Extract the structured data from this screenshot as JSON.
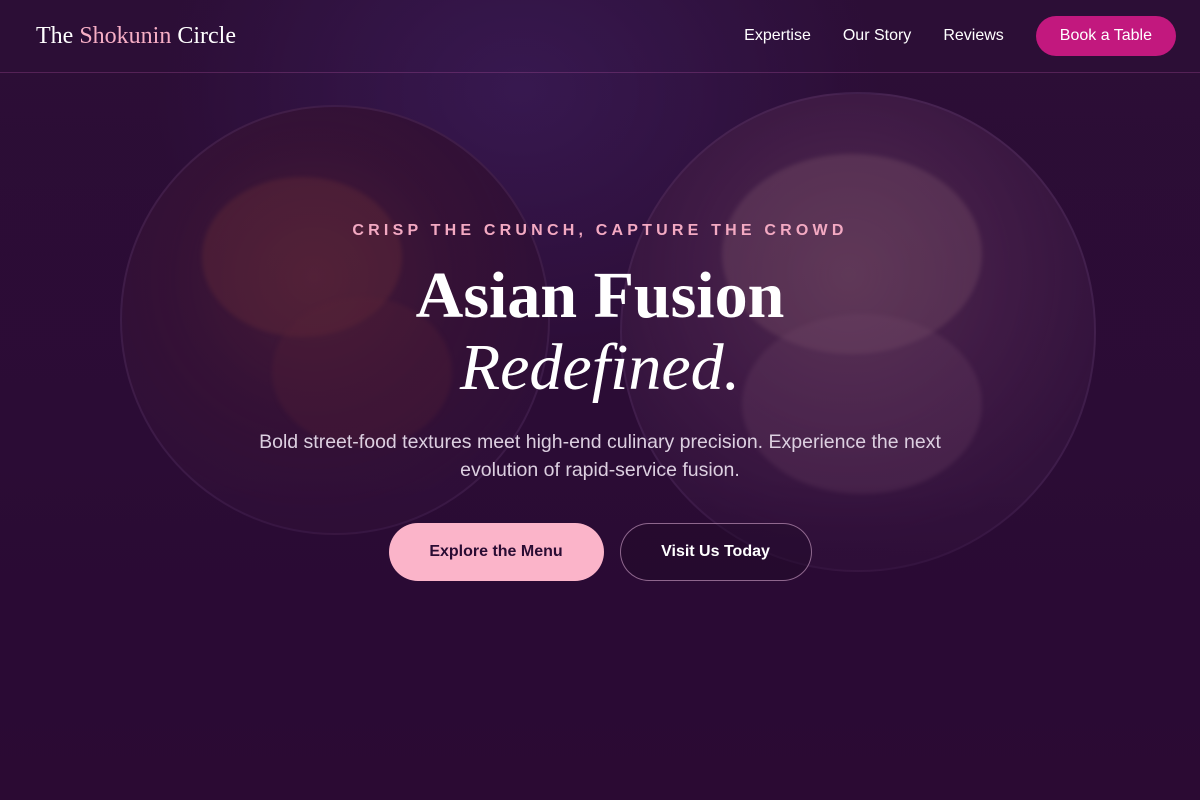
{
  "brand": {
    "prefix": "The ",
    "accent": "Shokunin",
    "suffix": " Circle"
  },
  "nav": {
    "links": [
      "Expertise",
      "Our Story",
      "Reviews"
    ],
    "cta": "Book a Table"
  },
  "hero": {
    "eyebrow": "CRISP THE CRUNCH, CAPTURE THE CROWD",
    "headline_line1": "Asian Fusion",
    "headline_line2": "Redefined.",
    "subtitle": "Bold street-food textures meet high-end culinary precision. Experience the next evolution of rapid-service fusion.",
    "primary_cta": "Explore the Menu",
    "secondary_cta": "Visit Us Today"
  },
  "colors": {
    "background": "#2a0c33",
    "accent_pink": "#f6aec5",
    "book_button": "#c2187e",
    "primary_button": "#fbb4c9"
  }
}
